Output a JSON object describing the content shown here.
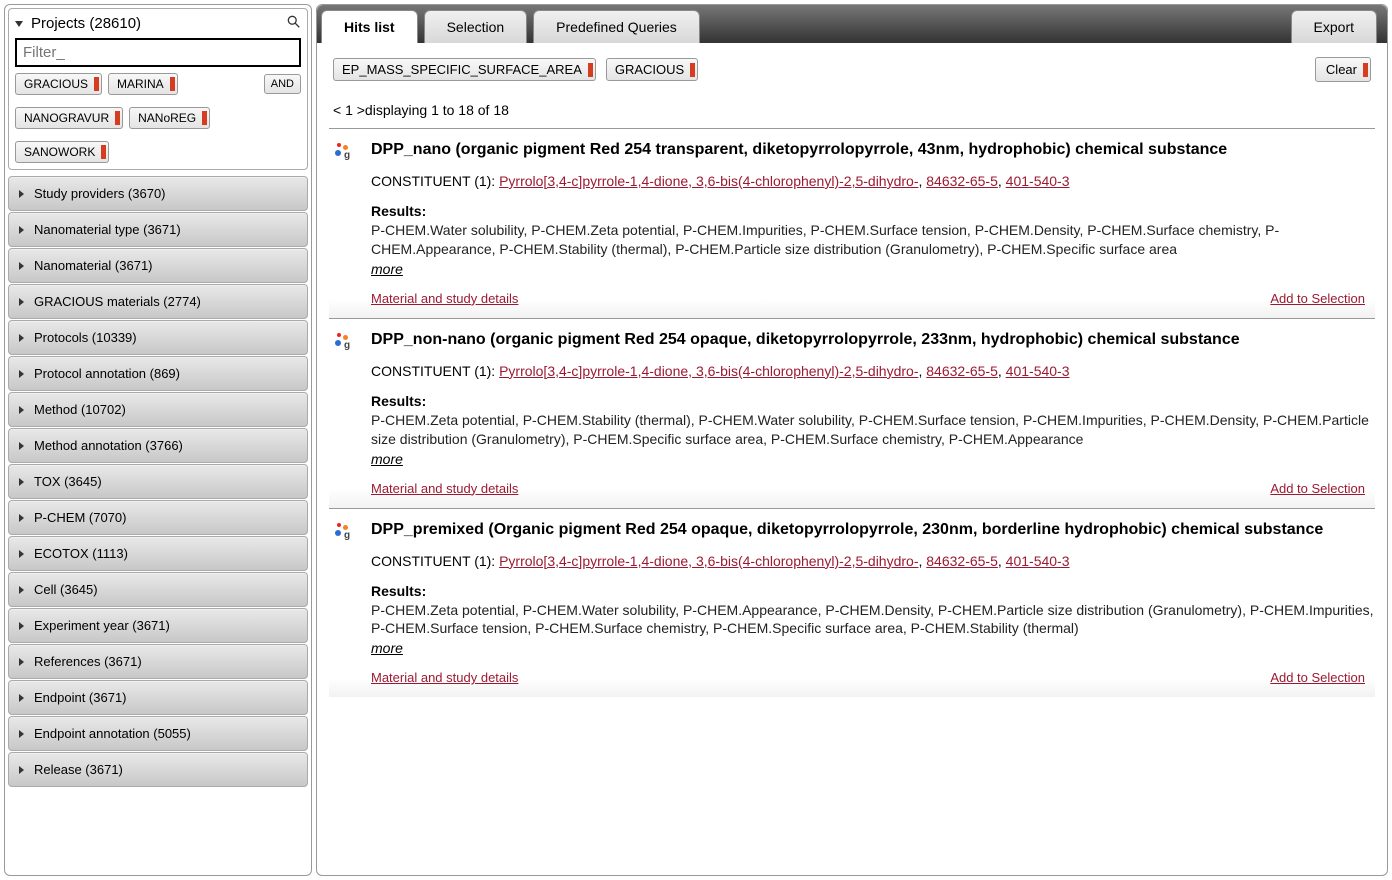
{
  "sidebar": {
    "projects_title": "Projects (28610)",
    "filter_placeholder": "Filter_",
    "and_label": "AND",
    "tags": [
      "GRACIOUS",
      "MARINA",
      "NANOGRAVUR",
      "NANoREG",
      "SANOWORK"
    ],
    "facets": [
      "Study providers (3670)",
      "Nanomaterial type (3671)",
      "Nanomaterial (3671)",
      "GRACIOUS materials (2774)",
      "Protocols (10339)",
      "Protocol annotation (869)",
      "Method (10702)",
      "Method annotation (3766)",
      "TOX (3645)",
      "P-CHEM (7070)",
      "ECOTOX (1113)",
      "Cell (3645)",
      "Experiment year (3671)",
      "References (3671)",
      "Endpoint (3671)",
      "Endpoint annotation (5055)",
      "Release (3671)"
    ]
  },
  "tabbar": {
    "tabs": [
      "Hits list",
      "Selection",
      "Predefined Queries"
    ],
    "export_label": "Export"
  },
  "filter_bar": {
    "tags": [
      "EP_MASS_SPECIFIC_SURFACE_AREA",
      "GRACIOUS"
    ],
    "clear_label": "Clear"
  },
  "pager": "< 1 >displaying 1 to 18 of 18",
  "results_common": {
    "results_label": "Results:",
    "more_label": "more",
    "details_label": "Material and study details",
    "add_label": "Add to Selection"
  },
  "results": [
    {
      "title": "DPP_nano (organic pigment Red 254 transparent, diketopyrrolopyrrole, 43nm, hydrophobic) chemical substance",
      "constituent_prefix": "CONSTITUENT (1): ",
      "constituent_links": [
        "Pyrrolo[3,4-c]pyrrole-1,4-dione, 3,6-bis(4-chlorophenyl)-2,5-dihydro-",
        "84632-65-5",
        "401-540-3"
      ],
      "result_text": "P-CHEM.Water solubility, P-CHEM.Zeta potential, P-CHEM.Impurities, P-CHEM.Surface tension, P-CHEM.Density, P-CHEM.Surface chemistry, P-CHEM.Appearance, P-CHEM.Stability (thermal), P-CHEM.Particle size distribution (Granulometry), P-CHEM.Specific surface area"
    },
    {
      "title": "DPP_non-nano (organic pigment Red 254 opaque, diketopyrrolopyrrole, 233nm, hydrophobic) chemical substance",
      "constituent_prefix": "CONSTITUENT (1): ",
      "constituent_links": [
        "Pyrrolo[3,4-c]pyrrole-1,4-dione, 3,6-bis(4-chlorophenyl)-2,5-dihydro-",
        "84632-65-5",
        "401-540-3"
      ],
      "result_text": "P-CHEM.Zeta potential, P-CHEM.Stability (thermal), P-CHEM.Water solubility, P-CHEM.Surface tension, P-CHEM.Impurities, P-CHEM.Density, P-CHEM.Particle size distribution (Granulometry), P-CHEM.Specific surface area, P-CHEM.Surface chemistry, P-CHEM.Appearance"
    },
    {
      "title": "DPP_premixed (Organic pigment Red 254 opaque, diketopyrrolopyrrole, 230nm, borderline hydrophobic) chemical substance",
      "constituent_prefix": "CONSTITUENT (1): ",
      "constituent_links": [
        "Pyrrolo[3,4-c]pyrrole-1,4-dione, 3,6-bis(4-chlorophenyl)-2,5-dihydro-",
        "84632-65-5",
        "401-540-3"
      ],
      "result_text": "P-CHEM.Zeta potential, P-CHEM.Water solubility, P-CHEM.Appearance, P-CHEM.Density, P-CHEM.Particle size distribution (Granulometry), P-CHEM.Impurities, P-CHEM.Surface tension, P-CHEM.Surface chemistry, P-CHEM.Specific surface area, P-CHEM.Stability (thermal)"
    }
  ]
}
